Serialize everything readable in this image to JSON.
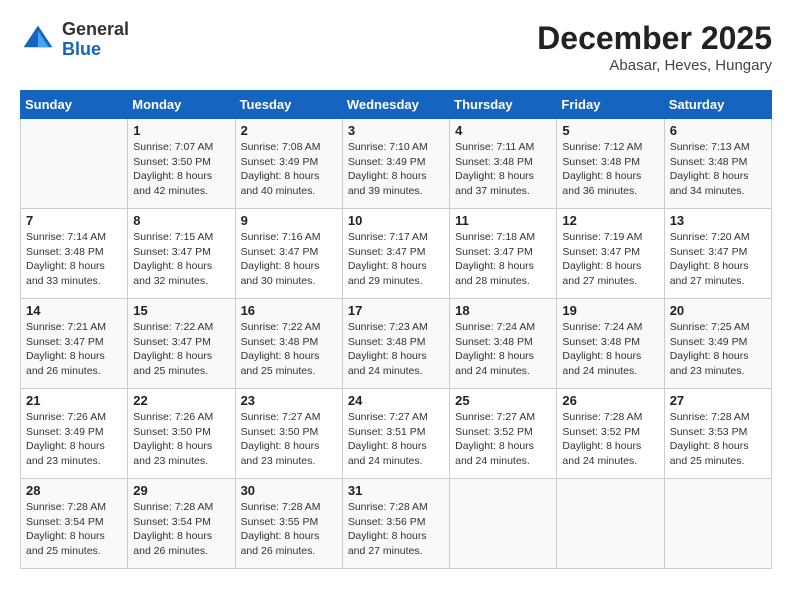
{
  "logo": {
    "general": "General",
    "blue": "Blue"
  },
  "title": "December 2025",
  "subtitle": "Abasar, Heves, Hungary",
  "weekdays": [
    "Sunday",
    "Monday",
    "Tuesday",
    "Wednesday",
    "Thursday",
    "Friday",
    "Saturday"
  ],
  "weeks": [
    [
      {
        "day": "",
        "info": ""
      },
      {
        "day": "1",
        "info": "Sunrise: 7:07 AM\nSunset: 3:50 PM\nDaylight: 8 hours\nand 42 minutes."
      },
      {
        "day": "2",
        "info": "Sunrise: 7:08 AM\nSunset: 3:49 PM\nDaylight: 8 hours\nand 40 minutes."
      },
      {
        "day": "3",
        "info": "Sunrise: 7:10 AM\nSunset: 3:49 PM\nDaylight: 8 hours\nand 39 minutes."
      },
      {
        "day": "4",
        "info": "Sunrise: 7:11 AM\nSunset: 3:48 PM\nDaylight: 8 hours\nand 37 minutes."
      },
      {
        "day": "5",
        "info": "Sunrise: 7:12 AM\nSunset: 3:48 PM\nDaylight: 8 hours\nand 36 minutes."
      },
      {
        "day": "6",
        "info": "Sunrise: 7:13 AM\nSunset: 3:48 PM\nDaylight: 8 hours\nand 34 minutes."
      }
    ],
    [
      {
        "day": "7",
        "info": "Sunrise: 7:14 AM\nSunset: 3:48 PM\nDaylight: 8 hours\nand 33 minutes."
      },
      {
        "day": "8",
        "info": "Sunrise: 7:15 AM\nSunset: 3:47 PM\nDaylight: 8 hours\nand 32 minutes."
      },
      {
        "day": "9",
        "info": "Sunrise: 7:16 AM\nSunset: 3:47 PM\nDaylight: 8 hours\nand 30 minutes."
      },
      {
        "day": "10",
        "info": "Sunrise: 7:17 AM\nSunset: 3:47 PM\nDaylight: 8 hours\nand 29 minutes."
      },
      {
        "day": "11",
        "info": "Sunrise: 7:18 AM\nSunset: 3:47 PM\nDaylight: 8 hours\nand 28 minutes."
      },
      {
        "day": "12",
        "info": "Sunrise: 7:19 AM\nSunset: 3:47 PM\nDaylight: 8 hours\nand 27 minutes."
      },
      {
        "day": "13",
        "info": "Sunrise: 7:20 AM\nSunset: 3:47 PM\nDaylight: 8 hours\nand 27 minutes."
      }
    ],
    [
      {
        "day": "14",
        "info": "Sunrise: 7:21 AM\nSunset: 3:47 PM\nDaylight: 8 hours\nand 26 minutes."
      },
      {
        "day": "15",
        "info": "Sunrise: 7:22 AM\nSunset: 3:47 PM\nDaylight: 8 hours\nand 25 minutes."
      },
      {
        "day": "16",
        "info": "Sunrise: 7:22 AM\nSunset: 3:48 PM\nDaylight: 8 hours\nand 25 minutes."
      },
      {
        "day": "17",
        "info": "Sunrise: 7:23 AM\nSunset: 3:48 PM\nDaylight: 8 hours\nand 24 minutes."
      },
      {
        "day": "18",
        "info": "Sunrise: 7:24 AM\nSunset: 3:48 PM\nDaylight: 8 hours\nand 24 minutes."
      },
      {
        "day": "19",
        "info": "Sunrise: 7:24 AM\nSunset: 3:48 PM\nDaylight: 8 hours\nand 24 minutes."
      },
      {
        "day": "20",
        "info": "Sunrise: 7:25 AM\nSunset: 3:49 PM\nDaylight: 8 hours\nand 23 minutes."
      }
    ],
    [
      {
        "day": "21",
        "info": "Sunrise: 7:26 AM\nSunset: 3:49 PM\nDaylight: 8 hours\nand 23 minutes."
      },
      {
        "day": "22",
        "info": "Sunrise: 7:26 AM\nSunset: 3:50 PM\nDaylight: 8 hours\nand 23 minutes."
      },
      {
        "day": "23",
        "info": "Sunrise: 7:27 AM\nSunset: 3:50 PM\nDaylight: 8 hours\nand 23 minutes."
      },
      {
        "day": "24",
        "info": "Sunrise: 7:27 AM\nSunset: 3:51 PM\nDaylight: 8 hours\nand 24 minutes."
      },
      {
        "day": "25",
        "info": "Sunrise: 7:27 AM\nSunset: 3:52 PM\nDaylight: 8 hours\nand 24 minutes."
      },
      {
        "day": "26",
        "info": "Sunrise: 7:28 AM\nSunset: 3:52 PM\nDaylight: 8 hours\nand 24 minutes."
      },
      {
        "day": "27",
        "info": "Sunrise: 7:28 AM\nSunset: 3:53 PM\nDaylight: 8 hours\nand 25 minutes."
      }
    ],
    [
      {
        "day": "28",
        "info": "Sunrise: 7:28 AM\nSunset: 3:54 PM\nDaylight: 8 hours\nand 25 minutes."
      },
      {
        "day": "29",
        "info": "Sunrise: 7:28 AM\nSunset: 3:54 PM\nDaylight: 8 hours\nand 26 minutes."
      },
      {
        "day": "30",
        "info": "Sunrise: 7:28 AM\nSunset: 3:55 PM\nDaylight: 8 hours\nand 26 minutes."
      },
      {
        "day": "31",
        "info": "Sunrise: 7:28 AM\nSunset: 3:56 PM\nDaylight: 8 hours\nand 27 minutes."
      },
      {
        "day": "",
        "info": ""
      },
      {
        "day": "",
        "info": ""
      },
      {
        "day": "",
        "info": ""
      }
    ]
  ]
}
